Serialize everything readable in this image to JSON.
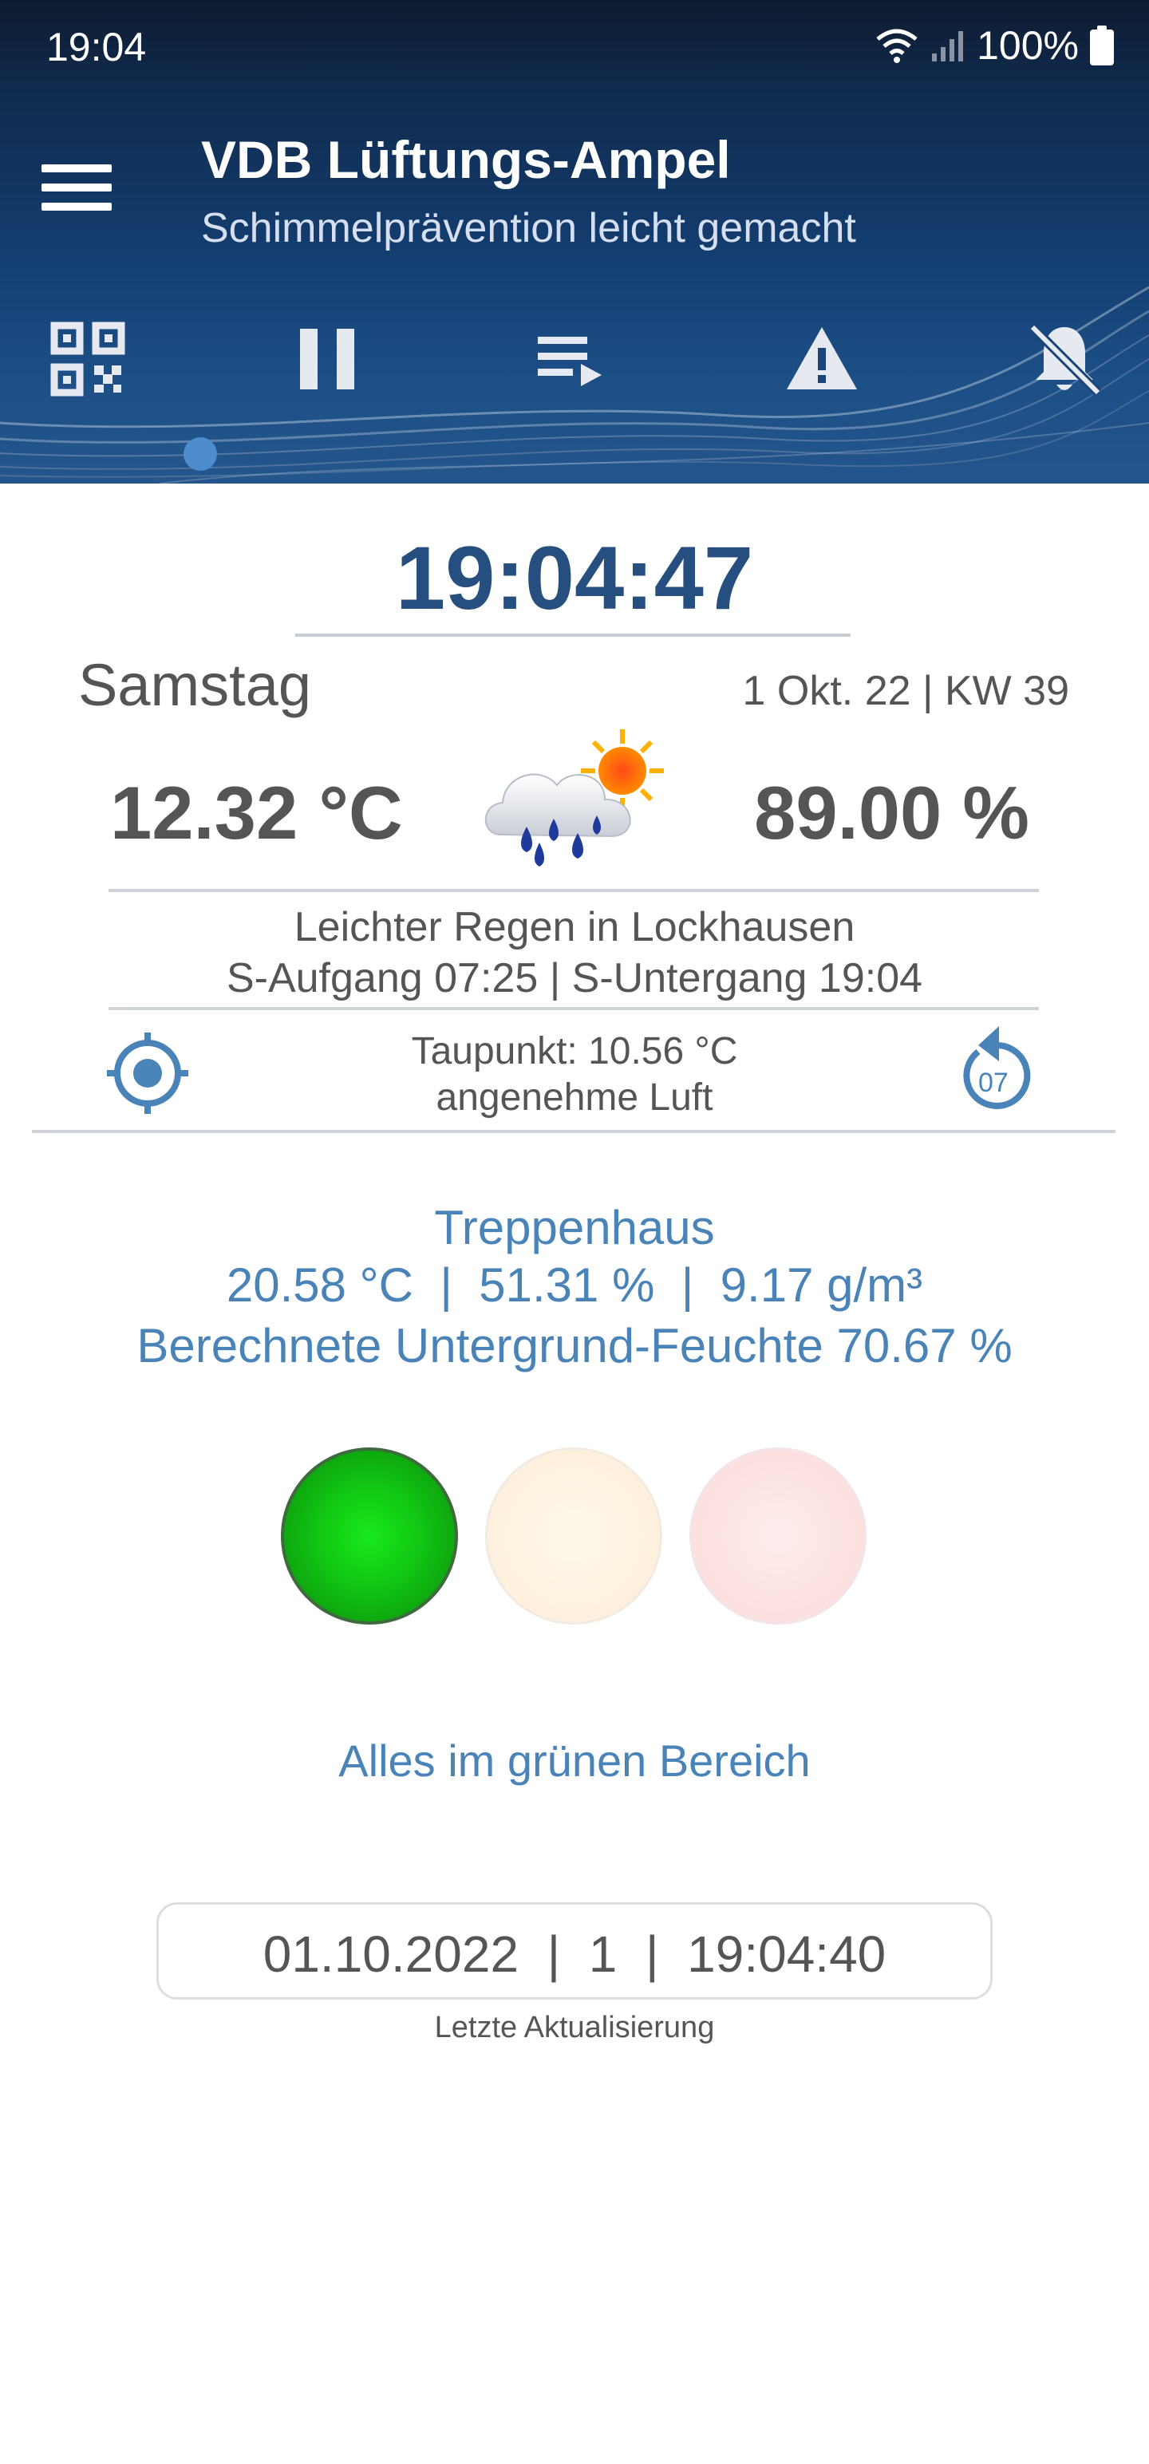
{
  "status_bar": {
    "time": "19:04",
    "battery": "100%"
  },
  "header": {
    "title": "VDB Lüftungs-Ampel",
    "subtitle": "Schimmelprävention leicht gemacht",
    "toolbar": [
      "qr-code-icon",
      "pause-icon",
      "playlist-icon",
      "warning-icon",
      "notifications-off-icon"
    ],
    "page_indicator": "1"
  },
  "clock": "19:04:47",
  "date": {
    "weekday": "Samstag",
    "date_kw": "1 Okt. 22 | KW 39"
  },
  "weather": {
    "temperature": "12.32 °C",
    "humidity": "89.00 %",
    "icon": "rain-cloud-sun-icon",
    "condition": "Leichter Regen in Lockhausen",
    "sun": "S-Aufgang 07:25 | S-Untergang 19:04",
    "dewpoint": "Taupunkt: 10.56 °C",
    "air_quality": "angenehme Luft",
    "replay_counter": "07"
  },
  "room": {
    "name": "Treppenhaus",
    "values": "20.58 °C  |  51.31 %  |  9.17 g/m³",
    "substrate": "Berechnete Untergrund-Feuchte 70.67 %"
  },
  "traffic_light": {
    "active": "green",
    "message": "Alles im grünen Bereich"
  },
  "last_update": {
    "value": "01.10.2022  |  1  |  19:04:40",
    "label": "Letzte Aktualisierung"
  },
  "colors": {
    "accent": "#4a83b8",
    "clock": "#264f80",
    "header": "#143f73"
  }
}
